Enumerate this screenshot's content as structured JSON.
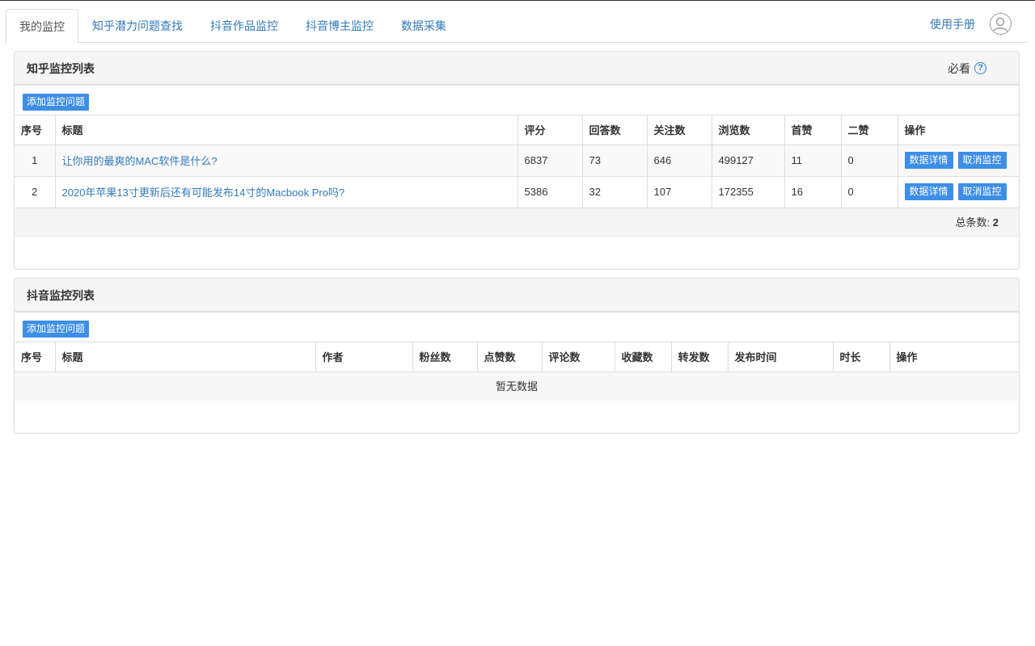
{
  "nav": {
    "tabs": [
      "我的监控",
      "知乎潜力问题查找",
      "抖音作品监控",
      "抖音博主监控",
      "数据采集"
    ],
    "active_tab": 0,
    "manual_label": "使用手册"
  },
  "zhihu_panel": {
    "title": "知乎监控列表",
    "must_see": "必看",
    "help_icon": "?",
    "add_button": "添加监控问题",
    "columns": [
      "序号",
      "标题",
      "评分",
      "回答数",
      "关注数",
      "浏览数",
      "首赞",
      "二赞",
      "操作"
    ],
    "rows": [
      {
        "index": "1",
        "title": "让你用的最爽的MAC软件是什么?",
        "score": "6837",
        "answers": "73",
        "followers": "646",
        "views": "499127",
        "first_like": "11",
        "second_like": "0"
      },
      {
        "index": "2",
        "title": "2020年苹果13寸更新后还有可能发布14寸的Macbook Pro吗?",
        "score": "5386",
        "answers": "32",
        "followers": "107",
        "views": "172355",
        "first_like": "16",
        "second_like": "0"
      }
    ],
    "detail_button": "数据详情",
    "cancel_button": "取消监控",
    "total_label": "总条数:",
    "total_value": "2"
  },
  "douyin_panel": {
    "title": "抖音监控列表",
    "add_button": "添加监控问题",
    "columns": [
      "序号",
      "标题",
      "作者",
      "粉丝数",
      "点赞数",
      "评论数",
      "收藏数",
      "转发数",
      "发布时间",
      "时长",
      "操作"
    ],
    "empty_text": "暂无数据"
  },
  "colors": {
    "accent": "#3e8ee6",
    "link": "#337ab7",
    "panel_heading_bg": "#f5f5f5"
  }
}
